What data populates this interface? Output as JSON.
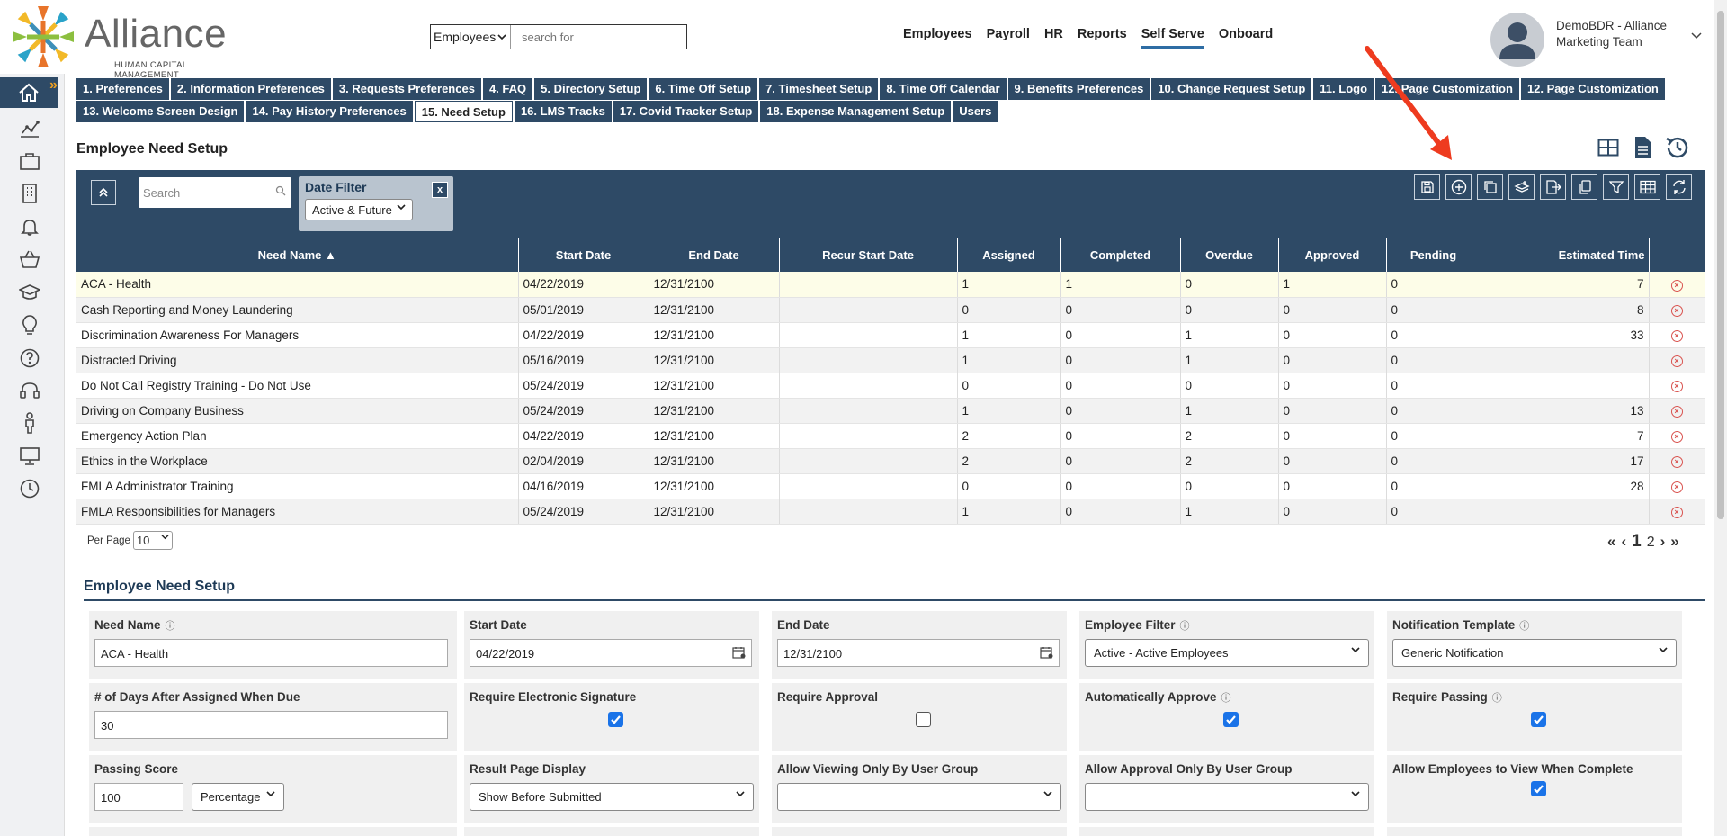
{
  "brand": {
    "name": "Alliance",
    "subtitle": "HUMAN CAPITAL MANAGEMENT"
  },
  "search": {
    "category": "Employees",
    "placeholder": "search for"
  },
  "topnav": [
    "Employees",
    "Payroll",
    "HR",
    "Reports",
    "Self Serve",
    "Onboard"
  ],
  "topnav_active": "Self Serve",
  "user": {
    "name": "DemoBDR - Alliance Marketing Team"
  },
  "tabs_row1": [
    "1. Preferences",
    "2. Information Preferences",
    "3. Requests Preferences",
    "4. FAQ",
    "5. Directory Setup",
    "6. Time Off Setup",
    "7. Timesheet Setup",
    "8. Time Off Calendar",
    "9. Benefits Preferences",
    "10. Change Request Setup",
    "11. Logo",
    "12. Page Customization",
    "12. Page Customization"
  ],
  "tabs_row2": [
    "13. Welcome Screen Design",
    "14. Pay History Preferences",
    "15. Need Setup",
    "16. LMS Tracks",
    "17. Covid Tracker Setup",
    "18. Expense Management Setup",
    "Users"
  ],
  "active_tab": "15. Need Setup",
  "page_title": "Employee Need Setup",
  "grid": {
    "search_placeholder": "Search",
    "date_filter_label": "Date Filter",
    "date_filter_value": "Active & Future",
    "date_filter_close": "x",
    "columns": [
      "Need Name ▲",
      "Start Date",
      "End Date",
      "Recur Start Date",
      "Assigned",
      "Completed",
      "Overdue",
      "Approved",
      "Pending",
      "Estimated Time"
    ],
    "rows": [
      [
        "ACA - Health",
        "04/22/2019",
        "12/31/2100",
        "",
        "1",
        "1",
        "0",
        "1",
        "0",
        "7"
      ],
      [
        "Cash Reporting and Money Laundering",
        "05/01/2019",
        "12/31/2100",
        "",
        "0",
        "0",
        "0",
        "0",
        "0",
        "8"
      ],
      [
        "Discrimination Awareness For Managers",
        "04/22/2019",
        "12/31/2100",
        "",
        "1",
        "0",
        "1",
        "0",
        "0",
        "33"
      ],
      [
        "Distracted Driving",
        "05/16/2019",
        "12/31/2100",
        "",
        "1",
        "0",
        "1",
        "0",
        "0",
        ""
      ],
      [
        "Do Not Call Registry Training - Do Not Use",
        "05/24/2019",
        "12/31/2100",
        "",
        "0",
        "0",
        "0",
        "0",
        "0",
        ""
      ],
      [
        "Driving on Company Business",
        "05/24/2019",
        "12/31/2100",
        "",
        "1",
        "0",
        "1",
        "0",
        "0",
        "13"
      ],
      [
        "Emergency Action Plan",
        "04/22/2019",
        "12/31/2100",
        "",
        "2",
        "0",
        "2",
        "0",
        "0",
        "7"
      ],
      [
        "Ethics in the Workplace",
        "02/04/2019",
        "12/31/2100",
        "",
        "2",
        "0",
        "2",
        "0",
        "0",
        "17"
      ],
      [
        "FMLA Administrator Training",
        "04/16/2019",
        "12/31/2100",
        "",
        "0",
        "0",
        "0",
        "0",
        "0",
        "28"
      ],
      [
        "FMLA Responsibilities for Managers",
        "05/24/2019",
        "12/31/2100",
        "",
        "1",
        "0",
        "1",
        "0",
        "0",
        ""
      ]
    ],
    "per_page_label": "Per Page",
    "per_page_value": "10",
    "pager": {
      "first": "«",
      "prev": "‹",
      "current": "1",
      "next_page": "2",
      "next": "›",
      "last": "»"
    }
  },
  "form": {
    "title": "Employee Need Setup",
    "need_name_label": "Need Name",
    "need_name_value": "ACA - Health",
    "start_date_label": "Start Date",
    "start_date_value": "04/22/2019",
    "end_date_label": "End Date",
    "end_date_value": "12/31/2100",
    "employee_filter_label": "Employee Filter",
    "employee_filter_value": "Active - Active Employees",
    "notification_template_label": "Notification Template",
    "notification_template_value": "Generic Notification",
    "days_due_label": "# of Days After Assigned When Due",
    "days_due_value": "30",
    "require_esig_label": "Require Electronic Signature",
    "require_esig": true,
    "require_approval_label": "Require Approval",
    "require_approval": false,
    "auto_approve_label": "Automatically Approve",
    "auto_approve": true,
    "require_passing_label": "Require Passing",
    "require_passing": true,
    "passing_score_label": "Passing Score",
    "passing_score_value": "100",
    "passing_score_type": "Percentage",
    "result_display_label": "Result Page Display",
    "result_display_value": "Show Before Submitted",
    "allow_view_group_label": "Allow Viewing Only By User Group",
    "allow_view_group_value": "",
    "allow_approval_group_label": "Allow Approval Only By User Group",
    "allow_approval_group_value": "",
    "allow_view_complete_label": "Allow Employees to View When Complete",
    "allow_view_complete": true
  },
  "colors": {
    "navy": "#2e4a66",
    "accent_orange": "#f0a020",
    "arrow_red": "#ee3b1f",
    "check_blue": "#1a73e8",
    "delete_red": "#d9534f"
  }
}
